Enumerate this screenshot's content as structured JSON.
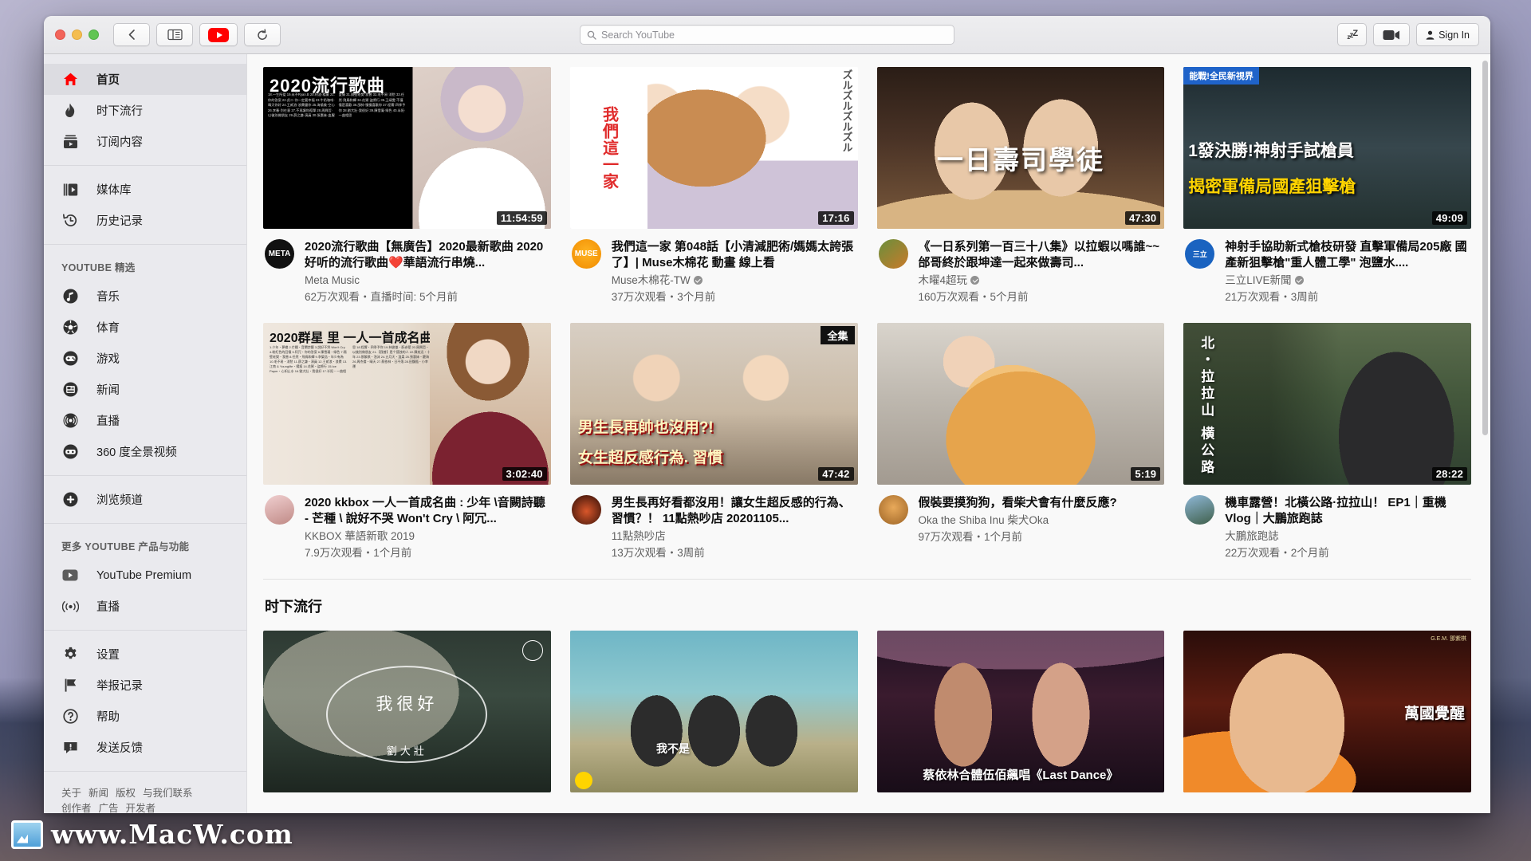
{
  "window": {
    "traffic_lights": [
      "close",
      "minimize",
      "maximize"
    ],
    "back_label": "Back",
    "sidebar_toggle_label": "Sidebar",
    "youtube_label": "YouTube",
    "reload_label": "Reload"
  },
  "search": {
    "placeholder": "Search YouTube",
    "icon": "search-icon"
  },
  "toolbar_right": {
    "sleep_label": "zzZ",
    "camera_label": "camera-icon",
    "signin_label": "Sign In"
  },
  "sidebar": {
    "primary": [
      {
        "label": "首页",
        "icon": "home-icon",
        "active": true
      },
      {
        "label": "时下流行",
        "icon": "flame-icon",
        "active": false
      },
      {
        "label": "订阅内容",
        "icon": "subscriptions-icon",
        "active": false
      }
    ],
    "library": [
      {
        "label": "媒体库",
        "icon": "library-icon"
      },
      {
        "label": "历史记录",
        "icon": "history-icon"
      }
    ],
    "best_of_heading": "YOUTUBE 精选",
    "best_of": [
      {
        "label": "音乐",
        "icon": "music-icon"
      },
      {
        "label": "体育",
        "icon": "sports-icon"
      },
      {
        "label": "游戏",
        "icon": "gaming-icon"
      },
      {
        "label": "新闻",
        "icon": "news-icon"
      },
      {
        "label": "直播",
        "icon": "live-icon"
      },
      {
        "label": "360 度全景视频",
        "icon": "vr360-icon"
      }
    ],
    "browse": {
      "label": "浏览频道",
      "icon": "plus-circle-icon"
    },
    "more_heading": "更多 YOUTUBE 产品与功能",
    "more": [
      {
        "label": "YouTube Premium",
        "icon": "youtube-icon"
      },
      {
        "label": "直播",
        "icon": "broadcast-icon"
      }
    ],
    "settings": [
      {
        "label": "设置",
        "icon": "gear-icon"
      },
      {
        "label": "举报记录",
        "icon": "flag-icon"
      },
      {
        "label": "帮助",
        "icon": "help-icon"
      },
      {
        "label": "发送反馈",
        "icon": "feedback-icon"
      }
    ],
    "footer_links_row1": [
      "关于",
      "新闻",
      "版权",
      "与我们联系"
    ],
    "footer_links_row2": [
      "创作者",
      "广告",
      "开发者"
    ]
  },
  "sections": {
    "trending_heading": "时下流行"
  },
  "videos_row1": [
    {
      "title": "2020流行歌曲【無廣告】2020最新歌曲 2020好听的流行歌曲❤️華語流行串燒...",
      "channel": "Meta Music",
      "verified": false,
      "stats": "62万次观看・直播时间: 5个月前",
      "duration": "11:54:59",
      "thumb_heading": "2020流行歌曲",
      "thumb_class": "t1",
      "avatar_text": "META"
    },
    {
      "title": "我們這一家 第048話【小清減肥術/媽媽太誇張了】| Muse木棉花 動畫 線上看",
      "channel": "Muse木棉花-TW",
      "verified": true,
      "stats": "37万次观看・3个月前",
      "duration": "17:16",
      "thumb_heading": "我們這一家",
      "thumb_class": "t2",
      "avatar_text": "MUSE"
    },
    {
      "title": "《一日系列第一百三十八集》以拉蝦以嗎誰~~邰哥終於跟坤達一起來做壽司...",
      "channel": "木曜4超玩",
      "verified": true,
      "stats": "160万次观看・5个月前",
      "duration": "47:30",
      "thumb_heading": "一日壽司學徒",
      "thumb_class": "t3",
      "avatar_text": ""
    },
    {
      "title": "神射手協助新式槍枝研發 直擊軍備局205廠 國產新狙擊槍\"重人體工學\" 泡鹽水....",
      "channel": "三立LIVE新聞",
      "verified": true,
      "stats": "21万次观看・3周前",
      "duration": "49:09",
      "thumb_tag": "能戰!全民新視界",
      "thumb_line1": "1發決勝!神射手試槍員",
      "thumb_line2": "揭密軍備局國產狙擊槍",
      "thumb_class": "t4",
      "avatar_text": "三立"
    }
  ],
  "videos_row2": [
    {
      "title": "2020 kkbox 一人一首成名曲 : 少年 \\音闕詩聽 - 芒種 \\ 說好不哭 Won't Cry \\ 阿冗...",
      "channel": "KKBOX 華語新歌 2019",
      "verified": false,
      "stats": "7.9万次观看・1个月前",
      "duration": "3:02:40",
      "thumb_heading": "2020群星 里 一人一首成名曲",
      "thumb_class": "t5",
      "avatar_text": ""
    },
    {
      "title": "男生長再好看都沒用！讓女生超反感的行為、習慣？！ 11點熱吵店 20201105...",
      "channel": "11點熱吵店",
      "verified": false,
      "stats": "13万次观看・3周前",
      "duration": "47:42",
      "thumb_tag": "全集",
      "thumb_line1": "男生長再帥也沒用?!",
      "thumb_line2": "女生超反感行為. 習慣",
      "thumb_class": "t6",
      "avatar_text": ""
    },
    {
      "title": "假裝要摸狗狗，看柴犬會有什麼反應?",
      "channel": "Oka the Shiba Inu 柴犬Oka",
      "verified": false,
      "stats": "97万次观看・1个月前",
      "duration": "5:19",
      "thumb_class": "t7",
      "avatar_text": ""
    },
    {
      "title": "機車露營！北橫公路·拉拉山！ EP1｜重機Vlog｜大鵬旅跑誌",
      "channel": "大鵬旅跑誌",
      "verified": false,
      "stats": "22万次观看・2个月前",
      "duration": "28:22",
      "thumb_heading": "北・拉拉山 横公路",
      "thumb_class": "t8",
      "avatar_text": ""
    }
  ],
  "videos_row3": [
    {
      "thumb_class": "t9",
      "thumb_line1": "我很好",
      "thumb_line2": "劉大壯"
    },
    {
      "thumb_class": "t10",
      "thumb_line1": "我不是"
    },
    {
      "thumb_class": "t11",
      "thumb_line1": "蔡依林合體伍佰飆唱《Last Dance》"
    },
    {
      "thumb_class": "t12",
      "thumb_line1": "萬國覺醒"
    }
  ],
  "watermark": {
    "text": "www.MacW.com"
  },
  "colors": {
    "youtube_red": "#ff0000",
    "sidebar_bg": "#eaeaee",
    "content_bg": "#f9f9f9",
    "text_primary": "#0d0d0d",
    "text_secondary": "#606060"
  }
}
